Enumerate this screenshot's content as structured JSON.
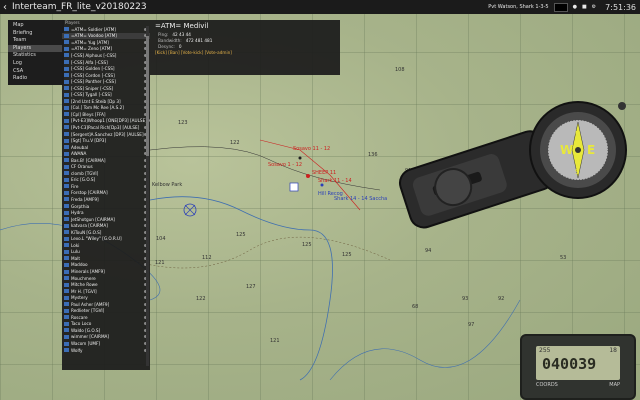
{
  "window": {
    "title": "Interteam_FR_lite_v20180223"
  },
  "topbar": {
    "status_text": "Pvt Watson, Shark 1-3-5",
    "time": "7:51:36"
  },
  "menu": {
    "items": [
      "Map",
      "Briefing",
      "Team",
      "Players",
      "Statistics",
      "Log",
      "CSA",
      "Radio"
    ],
    "active_index": 3
  },
  "players": {
    "header": "Players",
    "items": [
      "=ATM= Soldier [ATM]",
      "=ATM= Voodoo [ATM]",
      "=ATM= Yug [ATM]",
      "=ATM= Zeno [ATM]",
      "[-CSS] Alphous [-CSS]",
      "[-CSS] Alfa [-CSS]",
      "[-CSS] Golden [-CSS]",
      "[-CSS] Cordon [-CSS]",
      "[-CSS] Panther [-CSS]",
      "[-CSS] Sniper [-CSS]",
      "[-CSS] Tygall [-CSS]",
      "[2nd Ltnt E.Steib [Dp 3]",
      "[Col.] Tom Mc Ree [A.S.2]",
      "[Cpl] Bleys [FFA]",
      "[Pvt-E3]Whoop1 [ONE[DP3] [AULSE]",
      "[Pvt-C3]Pacal Rich[Dp3] [AULSE]",
      "[Sergent]A.Sanchez [DP3] [AULSE]",
      "[Sgt] Tru.V [DP3]",
      "Adeubal",
      "AWANA",
      "Bas.B! [CAIRMA]",
      "CF Oranus",
      "clomb [TGVI]",
      "Eric [G.O.S]",
      "Fire",
      "Forstop [CAIRMA]",
      "Freda [AMF9]",
      "Gorpthia",
      "Hydra",
      "JetShotgun [CAIRMA]",
      "katvara [CAIRMA]",
      "KiTouN [G.O.S]",
      "Lexo.L \"Wiley\" [G.O.R.U]",
      "Loki",
      "Lulu",
      "Malt",
      "Maddoo",
      "Minerals [AMF9]",
      "Mouchmere",
      "Mitche Rowe",
      "Mr H. [TGVI]",
      "Mystery",
      "Paul Asher [AMF9]",
      "Redlieter [TGVI]",
      "Roscare",
      "Taco Loco",
      "Waldo [G.O.S]",
      "wimmer [CAIRMA]",
      "Wacom [UMF]",
      "Wolfy"
    ],
    "selected_index": 1
  },
  "detail": {
    "name": "=ATM= Medivil",
    "ping_label": "Ping:",
    "ping_values": "42 43 44",
    "bandwidth_label": "Bandwidth:",
    "bandwidth_values": "472 481 481",
    "desync_label": "Desync:",
    "desync_value": "0",
    "links": "[Kick] [Ban] [Vote-kick] [Vote-admin]"
  },
  "map": {
    "labels": [
      "Sosavo 11 - 12",
      "SHEEP 11",
      "Shark 11 - 14",
      "Sosavo 1 - 12",
      "Hill Recog",
      "Shark 14 - 14 Saccha",
      "Kelbow Park"
    ],
    "elevations": [
      "108",
      "108",
      "123",
      "122",
      "136",
      "125",
      "125",
      "125",
      "121",
      "127",
      "122",
      "121",
      "93",
      "92",
      "68",
      "97",
      "94",
      "53",
      "104",
      "112",
      "131",
      "91",
      "106",
      "130"
    ],
    "accent_red": "#cc2020",
    "accent_blue": "#2a3fb8"
  },
  "gps": {
    "small_text": "255",
    "bearing_hint": "18",
    "digits": "040039",
    "buttons": [
      "COORDS",
      "MAP"
    ]
  }
}
